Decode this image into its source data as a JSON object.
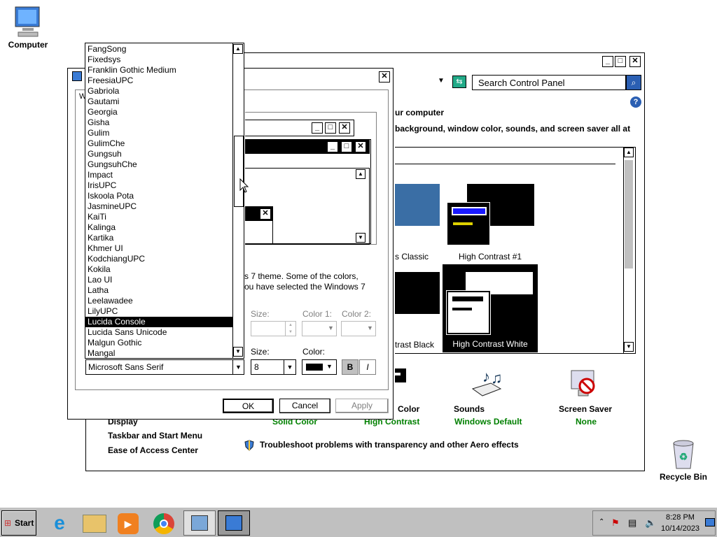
{
  "desktop": {
    "icons": [
      {
        "label": "Computer"
      },
      {
        "label": "Recycle Bin"
      }
    ]
  },
  "cp": {
    "search_placeholder": "Search Control Panel",
    "heading_tail": "ur computer",
    "desc_tail": "background, window color, sounds, and screen saver all at",
    "themes": [
      {
        "label": "s Classic"
      },
      {
        "label": "High Contrast #1"
      },
      {
        "label": "trast Black"
      },
      {
        "label": "High Contrast White"
      }
    ],
    "bottom": {
      "color_label": "Color",
      "color_value": "Solid Color",
      "color_value2": "High Contrast",
      "sounds_label": "Sounds",
      "sounds_value": "Windows Default",
      "saver_label": "Screen Saver",
      "saver_value": "None"
    },
    "see_also": {
      "display": "Display",
      "taskbar": "Taskbar and Start Menu",
      "ease": "Ease of Access Center"
    },
    "troubleshoot": "Troubleshoot problems with transparency and other Aero effects"
  },
  "dlg": {
    "tab": "W",
    "text1": "s 7 theme.  Some of the colors,",
    "text2": "ou have selected the Windows 7",
    "size_label": "Size:",
    "color1_label": "Color 1:",
    "color2_label": "Color 2:",
    "font_size_label": "Size:",
    "font_color_label": "Color:",
    "font_value": "Microsoft Sans Serif",
    "size_value": "8",
    "bold": "B",
    "italic": "I",
    "ok": "OK",
    "cancel": "Cancel",
    "apply": "Apply"
  },
  "fontlist": {
    "items": [
      "FangSong",
      "Fixedsys",
      "Franklin Gothic Medium",
      "FreesiaUPC",
      "Gabriola",
      "Gautami",
      "Georgia",
      "Gisha",
      "Gulim",
      "GulimChe",
      "Gungsuh",
      "GungsuhChe",
      "Impact",
      "IrisUPC",
      "Iskoola Pota",
      "JasmineUPC",
      "KaiTi",
      "Kalinga",
      "Kartika",
      "Khmer UI",
      "KodchiangUPC",
      "Kokila",
      "Lao UI",
      "Latha",
      "Leelawadee",
      "LilyUPC",
      "Lucida Console",
      "Lucida Sans Unicode",
      "Malgun Gothic",
      "Mangal"
    ],
    "selected": "Lucida Console"
  },
  "taskbar": {
    "start": "Start",
    "time": "8:28 PM",
    "date": "10/14/2023"
  },
  "colors": {
    "selection": "#000000",
    "link_green": "#008000",
    "taskbar": "#c0c0c0"
  }
}
